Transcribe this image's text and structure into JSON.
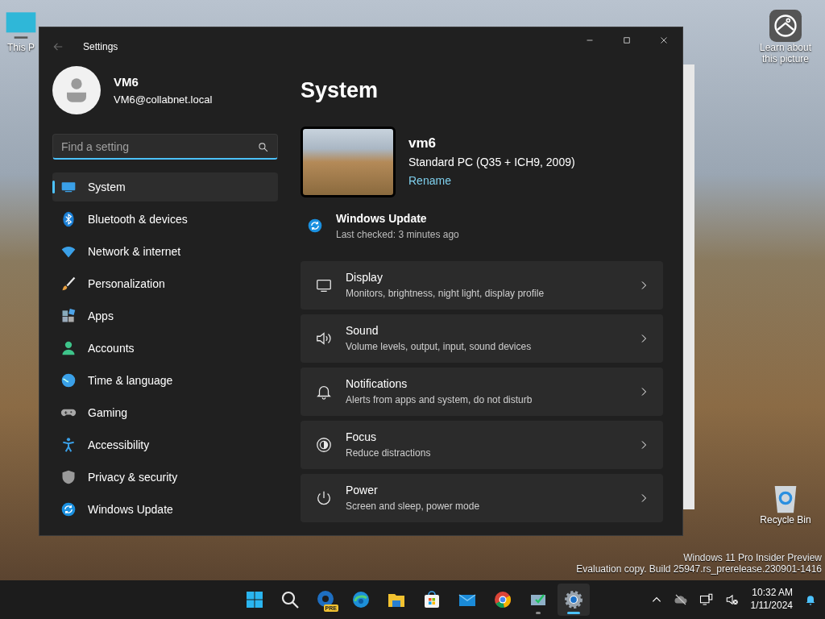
{
  "desktop": {
    "icons": [
      {
        "kind": "pc",
        "label": "This P"
      },
      {
        "kind": "picture",
        "label": "Learn about this picture"
      },
      {
        "kind": "bin",
        "label": "Recycle Bin"
      }
    ],
    "watermark": [
      "Windows 11 Pro Insider Preview",
      "Evaluation copy. Build 25947.rs_prerelease.230901-1416"
    ]
  },
  "window": {
    "title": "Settings",
    "user": {
      "name": "VM6",
      "email": "VM6@collabnet.local"
    },
    "search": {
      "placeholder": "Find a setting"
    },
    "nav": [
      {
        "kind": "system",
        "label": "System",
        "selected": true
      },
      {
        "kind": "bluetooth",
        "label": "Bluetooth & devices",
        "selected": false
      },
      {
        "kind": "network",
        "label": "Network & internet",
        "selected": false
      },
      {
        "kind": "brush",
        "label": "Personalization",
        "selected": false
      },
      {
        "kind": "apps",
        "label": "Apps",
        "selected": false
      },
      {
        "kind": "accounts",
        "label": "Accounts",
        "selected": false
      },
      {
        "kind": "time",
        "label": "Time & language",
        "selected": false
      },
      {
        "kind": "gaming",
        "label": "Gaming",
        "selected": false
      },
      {
        "kind": "accessibility",
        "label": "Accessibility",
        "selected": false
      },
      {
        "kind": "privacy",
        "label": "Privacy & security",
        "selected": false
      },
      {
        "kind": "update",
        "label": "Windows Update",
        "selected": false
      }
    ],
    "page_title": "System",
    "device": {
      "name": "vm6",
      "model": "Standard PC (Q35 + ICH9, 2009)",
      "rename": "Rename"
    },
    "update": {
      "title": "Windows Update",
      "status": "Last checked: 3 minutes ago"
    },
    "cards": [
      {
        "kind": "display",
        "title": "Display",
        "subtitle": "Monitors, brightness, night light, display profile"
      },
      {
        "kind": "sound",
        "title": "Sound",
        "subtitle": "Volume levels, output, input, sound devices"
      },
      {
        "kind": "notifications",
        "title": "Notifications",
        "subtitle": "Alerts from apps and system, do not disturb"
      },
      {
        "kind": "focus",
        "title": "Focus",
        "subtitle": "Reduce distractions"
      },
      {
        "kind": "power",
        "title": "Power",
        "subtitle": "Screen and sleep, power mode"
      }
    ]
  },
  "taskbar": {
    "apps": [
      {
        "kind": "start",
        "selected": false,
        "running": false
      },
      {
        "kind": "search",
        "selected": false,
        "running": false
      },
      {
        "kind": "edge-beta",
        "badge": "PRE",
        "selected": false,
        "running": false
      },
      {
        "kind": "edge",
        "selected": false,
        "running": false
      },
      {
        "kind": "folder",
        "selected": false,
        "running": false
      },
      {
        "kind": "store",
        "selected": false,
        "running": false
      },
      {
        "kind": "mail",
        "selected": false,
        "running": false
      },
      {
        "kind": "chrome",
        "selected": false,
        "running": false
      },
      {
        "kind": "monitor-app",
        "selected": false,
        "running": true
      },
      {
        "kind": "settings",
        "selected": true,
        "running": true
      }
    ],
    "time": "10:32 AM",
    "date": "1/11/2024"
  }
}
